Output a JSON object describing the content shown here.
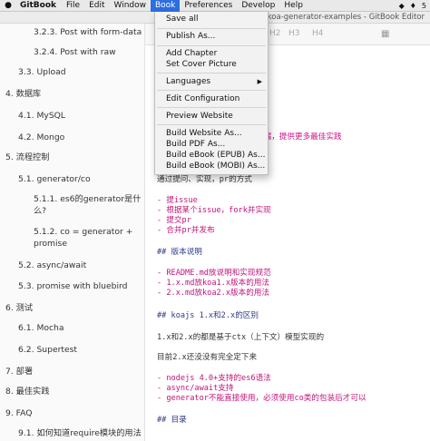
{
  "menubar": {
    "apple_icon": "apple-icon",
    "app_name": "GitBook",
    "items": [
      "File",
      "Edit",
      "Window",
      "Book",
      "Preferences",
      "Develop",
      "Help"
    ],
    "active": "Book",
    "status_number": "5"
  },
  "window": {
    "title": "koa-generator-examples - GitBook Editor"
  },
  "toolbar": {
    "h2": "H2",
    "h3": "H3",
    "h4": "H4"
  },
  "book_menu": {
    "items": [
      {
        "label": "Save all"
      },
      {
        "label": "Publish As..."
      },
      {
        "label": "Add Chapter"
      },
      {
        "label": "Set Cover Picture"
      },
      {
        "label": "Languages"
      },
      {
        "label": "Edit Configuration"
      },
      {
        "label": "Preview Website"
      },
      {
        "label": "Build Website As..."
      },
      {
        "label": "Build PDF As..."
      },
      {
        "label": "Build eBook (EPUB) As..."
      },
      {
        "label": "Build eBook (MOBI) As..."
      }
    ]
  },
  "sidebar": {
    "items": [
      "3.2.3. Post with form-data",
      "3.2.4. Post with raw",
      "3.3. Upload",
      "4. 数据库",
      "4.1. MySQL",
      "4.2. Mongo",
      "5. 流程控制",
      "5.1. generator/co",
      "5.1.1. es6的generator是什",
      "么?",
      "5.1.2. co = generator +",
      "promise",
      "5.2. async/await",
      "5.3. promise with bluebird",
      "6. 测试",
      "6.1. Mocha",
      "6.2. Supertest",
      "7. 部署",
      "8. 最佳实践",
      "9. FAQ",
      "9.1. 如何知道require模块的用法"
    ]
  },
  "editor": {
    "lines": [
      "补漏，提供更多最佳实践",
      "通过提问、实现，pr的方式",
      "- 提issue",
      "- 根据某个issue，fork并实现",
      "- 提交pr",
      "- 合并pr并发布",
      "## 版本说明",
      "- README.md放说明和实现规范",
      "  - 1.x.md放koa1.x版本的用法",
      "  - 2.x.md放koa2.x版本的用法",
      "## koajs 1.x和2.x的区别",
      "1.x和2.x的都是基于ctx（上下文）模型实现的",
      "目前2.x还没没有完全定下来",
      "- nodejs 4.0+支持的es6语法",
      "- async/await支持",
      "- generator不能直接使用，必须使用co类的包装后才可以",
      "## 目录"
    ]
  }
}
